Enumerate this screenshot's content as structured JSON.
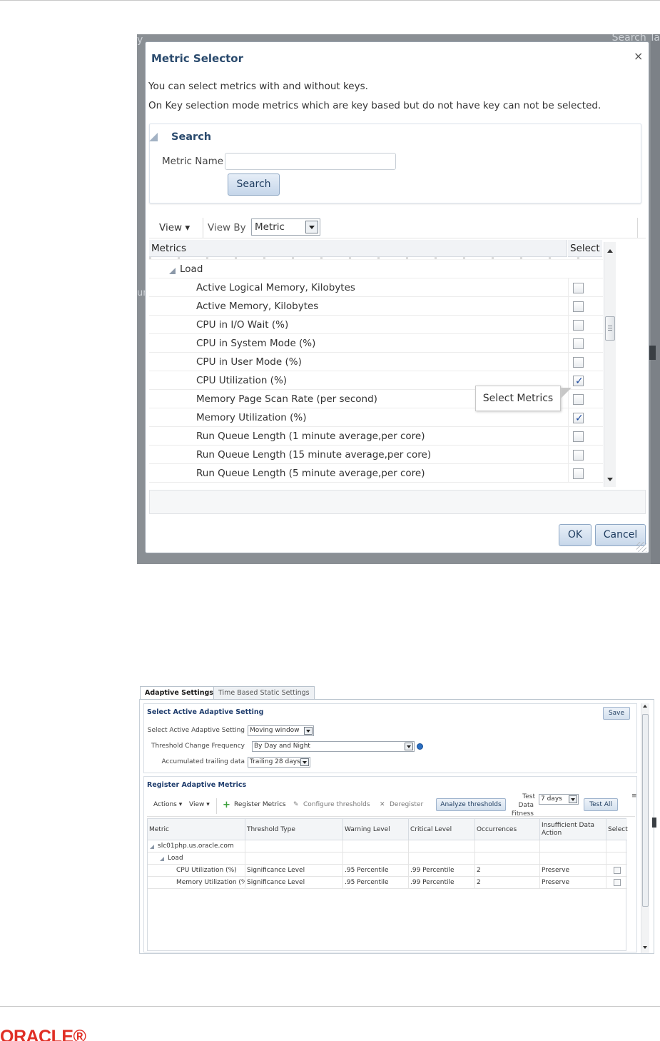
{
  "shot1": {
    "bg_left_text": "y",
    "bg_right_text": "Search Ta",
    "bg_left_fragment": "ur",
    "dialog": {
      "title": "Metric Selector",
      "close_glyph": "×",
      "info_line1": "You can select metrics with and without keys.",
      "info_line2": "On Key selection mode metrics which are key based but do not have key can not be selected.",
      "search": {
        "header": "Search",
        "metric_name_label": "Metric Name",
        "metric_name_value": "",
        "search_button": "Search"
      },
      "toolbar": {
        "view_label": "View ▾",
        "view_by_label": "View By",
        "view_by_value": "Metric"
      },
      "table": {
        "col_metrics": "Metrics",
        "col_select": "Select",
        "group_label": "Load",
        "rows": [
          {
            "name": "Active Logical Memory, Kilobytes",
            "checked": false
          },
          {
            "name": "Active Memory, Kilobytes",
            "checked": false
          },
          {
            "name": "CPU in I/O Wait (%)",
            "checked": false
          },
          {
            "name": "CPU in System Mode (%)",
            "checked": false
          },
          {
            "name": "CPU in User Mode (%)",
            "checked": false
          },
          {
            "name": "CPU Utilization (%)",
            "checked": true
          },
          {
            "name": "Memory Page Scan Rate (per second)",
            "checked": false
          },
          {
            "name": "Memory Utilization (%)",
            "checked": true
          },
          {
            "name": "Run Queue Length (1 minute average,per core)",
            "checked": false
          },
          {
            "name": "Run Queue Length (15 minute average,per core)",
            "checked": false
          },
          {
            "name": "Run Queue Length (5 minute average,per core)",
            "checked": false
          }
        ]
      },
      "tooltip": "Select Metrics",
      "ok_button": "OK",
      "cancel_button": "Cancel"
    }
  },
  "shot2": {
    "tabs": [
      {
        "label": "Adaptive Settings",
        "active": true
      },
      {
        "label": "Time Based Static Settings",
        "active": false
      }
    ],
    "section1": {
      "header": "Select Active Adaptive Setting",
      "save_button": "Save",
      "fields": [
        {
          "label": "Select Active Adaptive Setting",
          "value": "Moving window"
        },
        {
          "label": "Threshold Change Frequency",
          "value": "By Day and Night"
        },
        {
          "label": "Accumulated trailing data",
          "value": "Trailing 28 days"
        }
      ]
    },
    "section2": {
      "header": "Register Adaptive Metrics",
      "toolbar": {
        "actions": "Actions ▾",
        "view": "View ▾",
        "register": "Register Metrics",
        "configure": "Configure thresholds",
        "deregister": "Deregister",
        "analyze": "Analyze thresholds",
        "test_label_1": "Test",
        "test_label_2": "Data",
        "test_label_3": "Fitness",
        "test_value": "7 days",
        "test_all": "Test All"
      },
      "columns": [
        "Metric",
        "Threshold Type",
        "Warning Level",
        "Critical Level",
        "Occurrences",
        "Insufficient Data Action",
        "Select"
      ],
      "host": "slc01php.us.oracle.com",
      "group": "Load",
      "rows": [
        {
          "metric": "CPU Utilization (%)",
          "threshold_type": "Significance Level",
          "warning": ".95 Percentile",
          "critical": ".99 Percentile",
          "occurrences": "2",
          "action": "Preserve",
          "checked": false
        },
        {
          "metric": "Memory Utilization (%)",
          "threshold_type": "Significance Level",
          "warning": ".95 Percentile",
          "critical": ".99 Percentile",
          "occurrences": "2",
          "action": "Preserve",
          "checked": false
        }
      ]
    }
  },
  "footer": {
    "logo_text": "ORACLE®"
  },
  "colors": {
    "accent_red": "#e02f25",
    "header_blue": "#2a4a6d",
    "button_blue": "#c5d6ea"
  }
}
